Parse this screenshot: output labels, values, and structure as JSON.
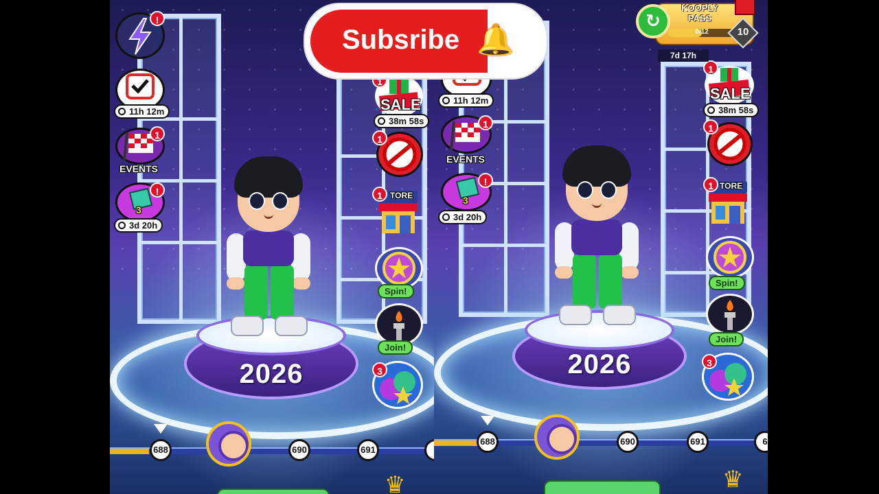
{
  "subscribe": {
    "label": "Subsribe",
    "bell_icon": "bell-icon"
  },
  "kooply_pass": {
    "title": "KOOPLY\nPASS",
    "progress": "6/12",
    "progress_fraction": 0.5,
    "level": "10",
    "timer": "7d 17h"
  },
  "left": {
    "daily_timer": "11h 12m",
    "events_label": "EVENTS",
    "events_badge": "1",
    "energy_badge": "!",
    "calendar_badge": "",
    "pack_count": "3",
    "pack_timer": "3d 20h",
    "pack_badge": "!",
    "sale_label": "SALE",
    "sale_badge": "1",
    "sale_timer": "38m 58s",
    "noads_badge": "1",
    "store_label": "TORE",
    "store_badge": "1",
    "spin_label": "Spin!",
    "join_label": "Join!",
    "friends_badge": "3",
    "pedestal_year": "2026",
    "levels": [
      "688",
      "690",
      "691"
    ],
    "track_fill_fraction": 0.12
  },
  "right": {
    "daily_timer": "11h 12m",
    "events_label": "EVENTS",
    "events_badge": "1",
    "pack_count": "3",
    "pack_timer": "3d 20h",
    "pack_badge": "!",
    "sale_label": "SALE",
    "sale_badge": "1",
    "sale_timer": "38m 58s",
    "noads_badge": "1",
    "store_label": "TORE",
    "store_badge": "1",
    "spin_label": "Spin!",
    "join_label": "Join!",
    "friends_badge": "3",
    "pedestal_year": "2026",
    "levels": [
      "688",
      "690",
      "691",
      "6"
    ],
    "track_fill_fraction": 0.17
  },
  "colors": {
    "accent_red": "#e41e1e",
    "pass_gold": "#f0a92b",
    "badge_red": "#e0102c",
    "label_green": "#6ee05a"
  }
}
